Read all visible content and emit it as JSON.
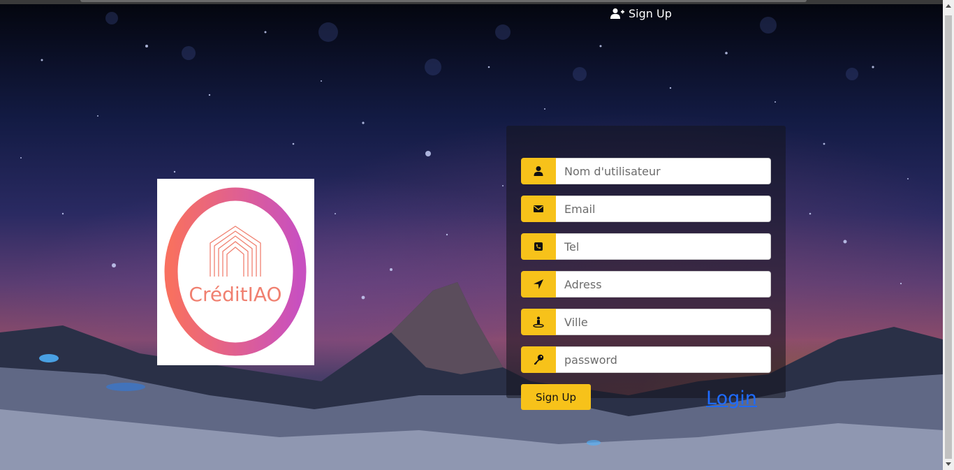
{
  "nav": {
    "signup_label": "Sign Up",
    "signup_icon": "user-plus-icon"
  },
  "logo": {
    "text": "CréditIAO",
    "ring_colors": [
      "#f87060",
      "#c850c0"
    ]
  },
  "form": {
    "fields": [
      {
        "name": "username",
        "placeholder": "Nom d'utilisateur",
        "value": "",
        "icon": "user-icon"
      },
      {
        "name": "email",
        "placeholder": "Email",
        "value": "",
        "icon": "envelope-icon"
      },
      {
        "name": "tel",
        "placeholder": "Tel",
        "value": "",
        "icon": "phone-icon"
      },
      {
        "name": "address",
        "placeholder": "Adress",
        "value": "",
        "icon": "location-arrow-icon"
      },
      {
        "name": "city",
        "placeholder": "Ville",
        "value": "",
        "icon": "street-view-icon"
      },
      {
        "name": "password",
        "placeholder": "password",
        "value": "",
        "icon": "key-icon"
      }
    ],
    "submit_label": "Sign Up",
    "login_label": "Login"
  },
  "colors": {
    "accent": "#f7c21a",
    "link": "#1e6bff"
  }
}
